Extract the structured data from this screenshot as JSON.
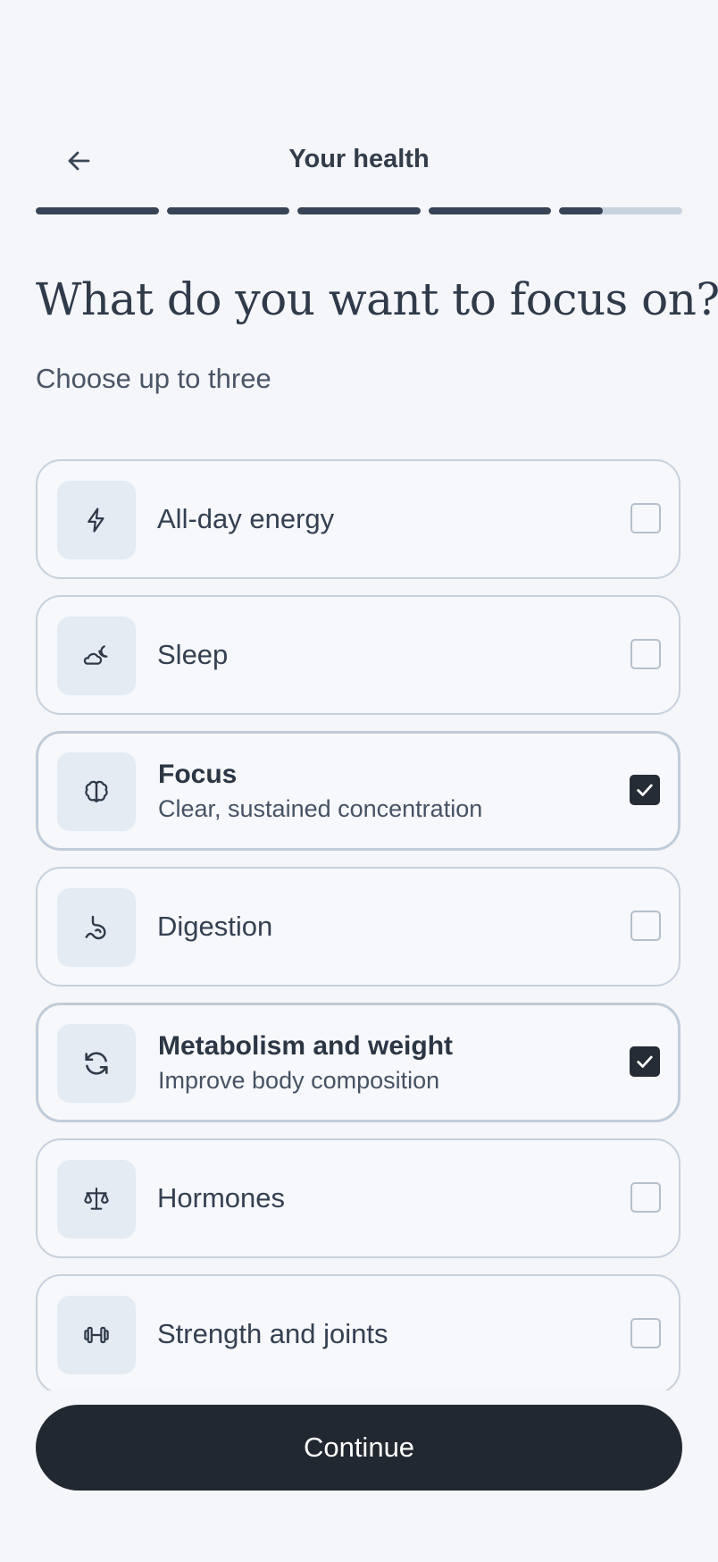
{
  "header": {
    "title": "Your health",
    "back_icon": "arrow-left-icon"
  },
  "progress": {
    "segments": 5,
    "filled_segments": 4,
    "current_segment_fraction": 0.35
  },
  "question": {
    "title": "What do you want to focus on?",
    "subtitle": "Choose up to three"
  },
  "options": [
    {
      "label": "All-day energy",
      "sublabel": "",
      "icon": "lightning-bolt-icon",
      "checked": false
    },
    {
      "label": "Sleep",
      "sublabel": "",
      "icon": "cloud-moon-icon",
      "checked": false
    },
    {
      "label": "Focus",
      "sublabel": "Clear, sustained concentration",
      "icon": "brain-icon",
      "checked": true
    },
    {
      "label": "Digestion",
      "sublabel": "",
      "icon": "stomach-icon",
      "checked": false
    },
    {
      "label": "Metabolism and weight",
      "sublabel": "Improve body composition",
      "icon": "refresh-cycle-icon",
      "checked": true
    },
    {
      "label": "Hormones",
      "sublabel": "",
      "icon": "balance-scale-icon",
      "checked": false
    },
    {
      "label": "Strength and joints",
      "sublabel": "",
      "icon": "dumbbell-icon",
      "checked": false
    }
  ],
  "footer": {
    "continue_label": "Continue"
  },
  "colors": {
    "background": "#f4f6fa",
    "accent_dark": "#222831",
    "progress_filled": "#374456",
    "progress_empty": "#c9d3df",
    "icon_tile": "#e4ebf3"
  }
}
